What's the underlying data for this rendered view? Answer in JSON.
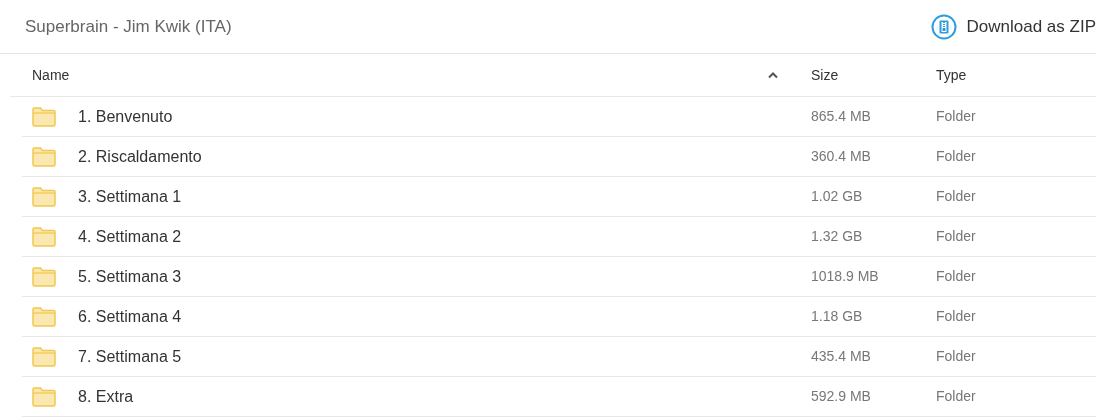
{
  "header": {
    "title": "Superbrain - Jim Kwik (ITA)",
    "download_button": "Download as ZIP"
  },
  "table": {
    "columns": [
      {
        "label": "Name",
        "sorted": true
      },
      {
        "label": "Size",
        "sorted": false
      },
      {
        "label": "Type",
        "sorted": false
      }
    ],
    "rows": [
      {
        "name": "1. Benvenuto",
        "size": "865.4 MB",
        "type": "Folder"
      },
      {
        "name": "2. Riscaldamento",
        "size": "360.4 MB",
        "type": "Folder"
      },
      {
        "name": "3. Settimana 1",
        "size": "1.02 GB",
        "type": "Folder"
      },
      {
        "name": "4. Settimana 2",
        "size": "1.32 GB",
        "type": "Folder"
      },
      {
        "name": "5. Settimana 3",
        "size": "1018.9 MB",
        "type": "Folder"
      },
      {
        "name": "6. Settimana 4",
        "size": "1.18 GB",
        "type": "Folder"
      },
      {
        "name": "7. Settimana 5",
        "size": "435.4 MB",
        "type": "Folder"
      },
      {
        "name": "8. Extra",
        "size": "592.9 MB",
        "type": "Folder"
      }
    ]
  }
}
